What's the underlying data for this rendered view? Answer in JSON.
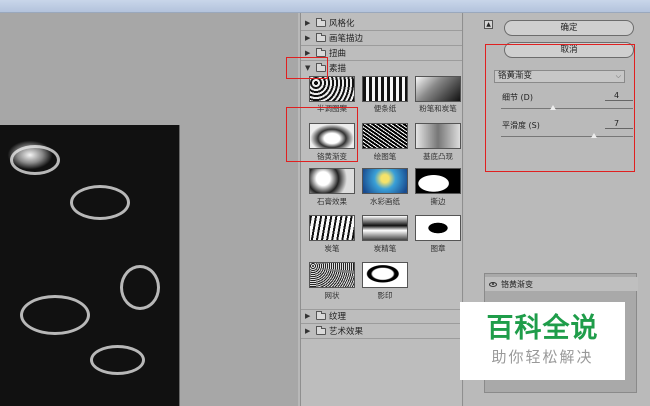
{
  "gallery": {
    "folders_top": [
      {
        "label": "风格化",
        "expanded": false
      },
      {
        "label": "画笔描边",
        "expanded": false
      },
      {
        "label": "扭曲",
        "expanded": false
      },
      {
        "label": "素描",
        "expanded": true
      }
    ],
    "thumbnails": [
      {
        "label": "半调图案"
      },
      {
        "label": "便条纸"
      },
      {
        "label": "粉笔和炭笔"
      },
      {
        "label": "铬黄渐变"
      },
      {
        "label": "绘图笔"
      },
      {
        "label": "基底凸现"
      },
      {
        "label": "石膏效果"
      },
      {
        "label": "水彩画纸"
      },
      {
        "label": "撕边"
      },
      {
        "label": "炭笔"
      },
      {
        "label": "炭精笔"
      },
      {
        "label": "图章"
      },
      {
        "label": "网状"
      },
      {
        "label": "影印"
      }
    ],
    "folders_bottom": [
      {
        "label": "纹理",
        "expanded": false
      },
      {
        "label": "艺术效果",
        "expanded": false
      }
    ]
  },
  "right": {
    "ok_label": "确定",
    "cancel_label": "取消",
    "filter_select": "铬黄渐变",
    "params": [
      {
        "label": "细节 (D)",
        "value": "4"
      },
      {
        "label": "平滑度 (S)",
        "value": "7"
      }
    ],
    "layer_name": "铬黄渐变"
  },
  "watermark": {
    "title": "百科全说",
    "subtitle": "助你轻松解决"
  }
}
